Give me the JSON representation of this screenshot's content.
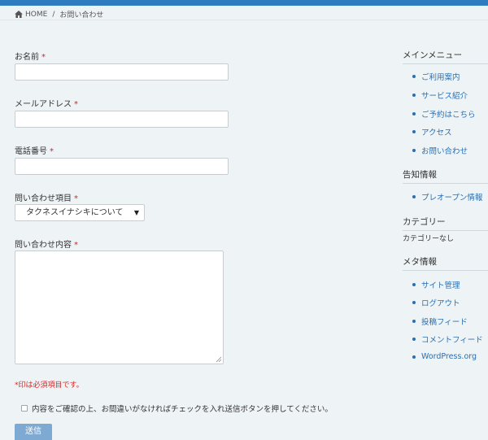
{
  "breadcrumb": {
    "home_label": "HOME",
    "separator": "/",
    "current": "お問い合わせ"
  },
  "form": {
    "name_label": "お名前",
    "email_label": "メールアドレス",
    "phone_label": "電話番号",
    "subject_label": "問い合わせ項目",
    "subject_selected": "タクネスイナシキについて",
    "content_label": "問い合わせ内容",
    "required_mark": "*",
    "required_note": "*印は必須項目です。",
    "confirm_text": "内容をご確認の上、お間違いがなければチェックを入れ送信ボタンを押してください。",
    "submit_label": "送信"
  },
  "sidebar": {
    "main_menu": {
      "title": "メインメニュー",
      "items": [
        "ご利用案内",
        "サービス紹介",
        "ご予約はこちら",
        "アクセス",
        "お問い合わせ"
      ]
    },
    "notices": {
      "title": "告知情報",
      "items": [
        "プレオープン情報"
      ]
    },
    "categories": {
      "title": "カテゴリー",
      "empty_text": "カテゴリーなし"
    },
    "meta": {
      "title": "メタ情報",
      "items": [
        "サイト管理",
        "ログアウト",
        "投稿フィード",
        "コメントフィード",
        "WordPress.org"
      ]
    }
  },
  "colors": {
    "accent": "#2f7bbf",
    "link": "#2a6fb0",
    "required": "#e02020",
    "button": "#7ea9d2",
    "background": "#eef3f6"
  }
}
